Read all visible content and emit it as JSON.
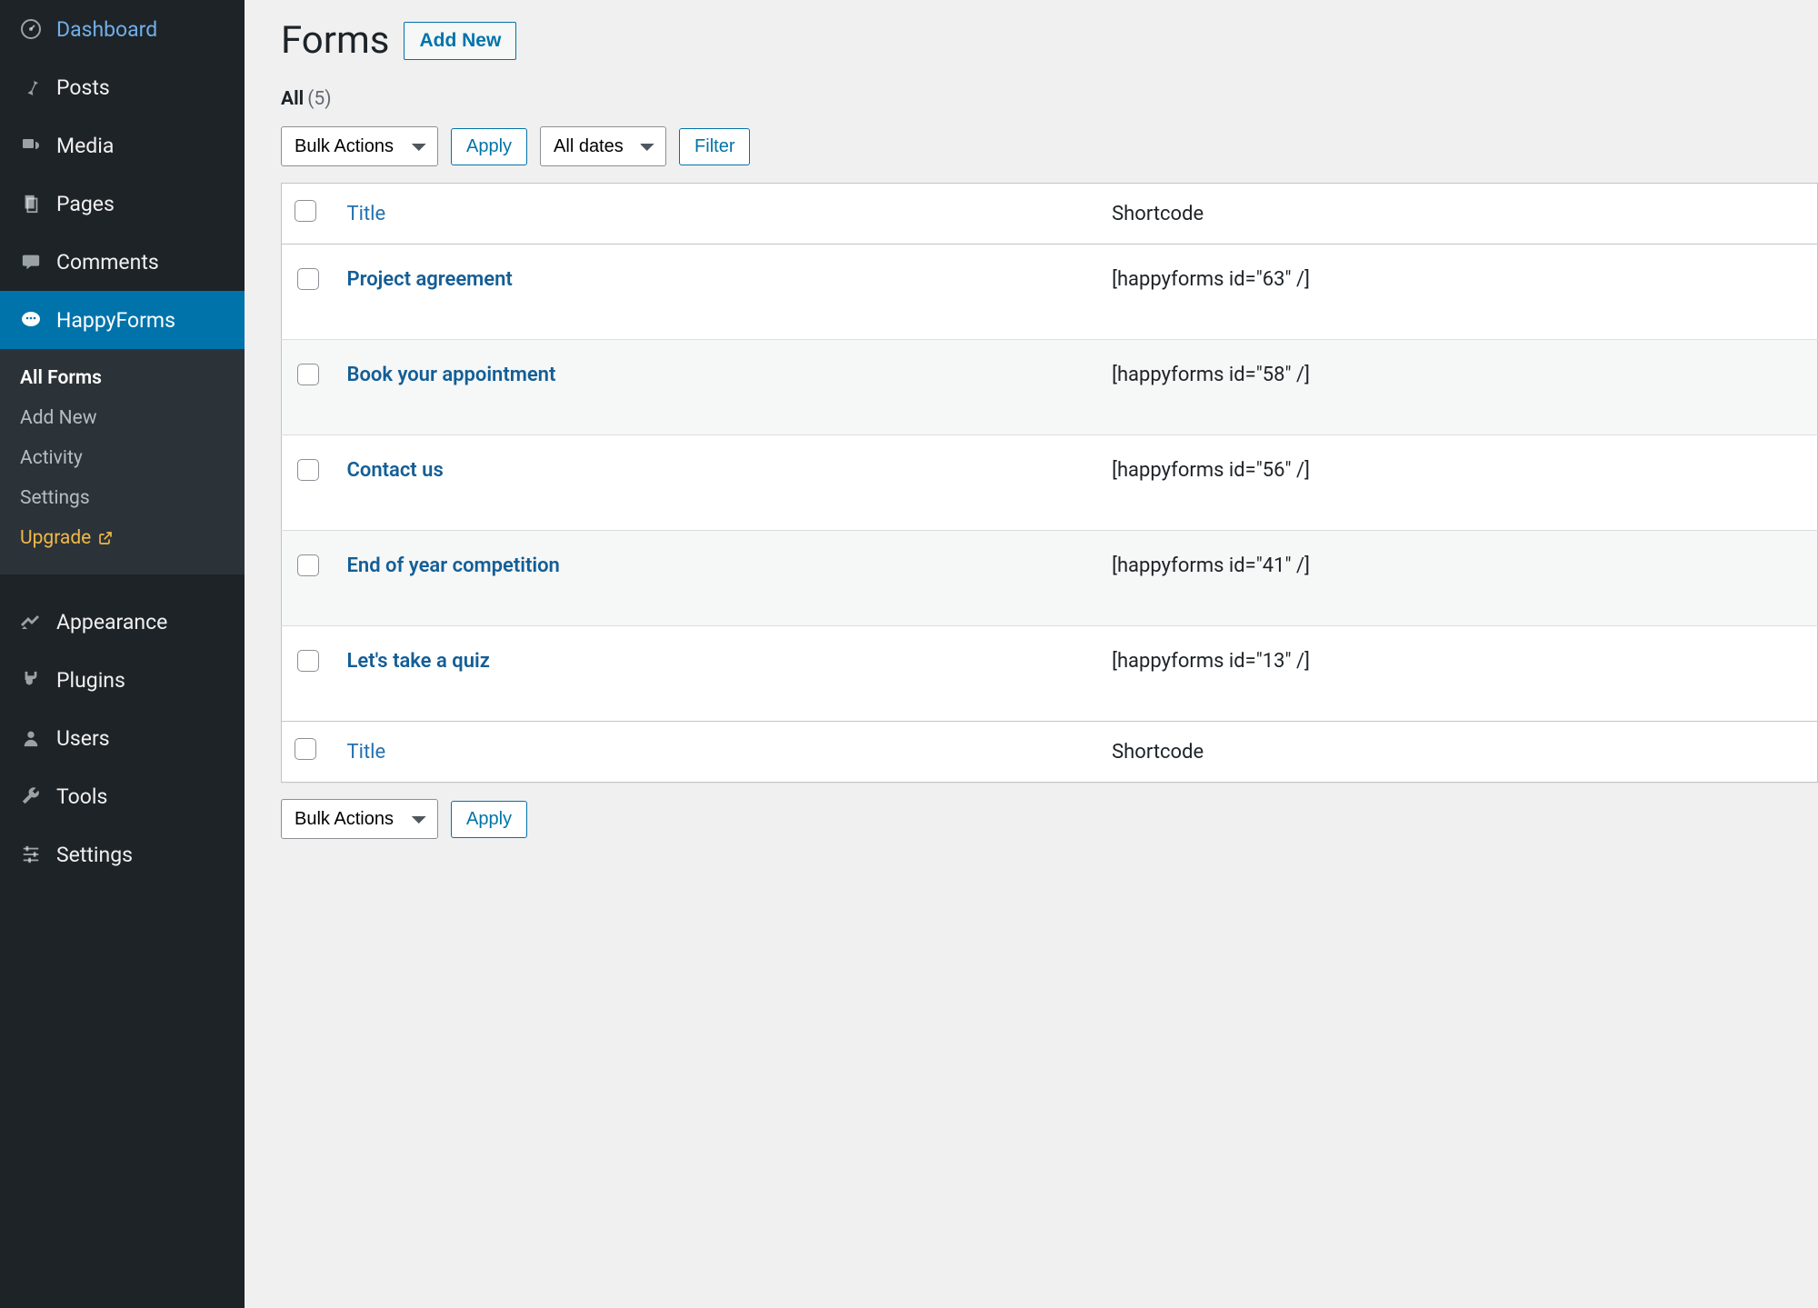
{
  "sidebar": {
    "items": [
      {
        "label": "Dashboard",
        "icon": "dashboard"
      },
      {
        "label": "Posts",
        "icon": "pin"
      },
      {
        "label": "Media",
        "icon": "media"
      },
      {
        "label": "Pages",
        "icon": "pages"
      },
      {
        "label": "Comments",
        "icon": "comments"
      },
      {
        "label": "HappyForms",
        "icon": "happyforms",
        "active": true
      },
      {
        "label": "Appearance",
        "icon": "appearance"
      },
      {
        "label": "Plugins",
        "icon": "plugins"
      },
      {
        "label": "Users",
        "icon": "users"
      },
      {
        "label": "Tools",
        "icon": "tools"
      },
      {
        "label": "Settings",
        "icon": "settings"
      }
    ],
    "submenu": [
      {
        "label": "All Forms",
        "current": true
      },
      {
        "label": "Add New"
      },
      {
        "label": "Activity"
      },
      {
        "label": "Settings"
      },
      {
        "label": "Upgrade",
        "upgrade": true
      }
    ]
  },
  "page": {
    "title": "Forms",
    "add_new": "Add New"
  },
  "filters": {
    "all_label": "All",
    "count": "(5)"
  },
  "tablenav": {
    "bulk": "Bulk Actions",
    "apply": "Apply",
    "dates": "All dates",
    "filter": "Filter"
  },
  "table": {
    "columns": {
      "title": "Title",
      "shortcode": "Shortcode"
    },
    "rows": [
      {
        "title": "Project agreement",
        "shortcode": "[happyforms id=\"63\" /]"
      },
      {
        "title": "Book your appointment",
        "shortcode": "[happyforms id=\"58\" /]"
      },
      {
        "title": "Contact us",
        "shortcode": "[happyforms id=\"56\" /]"
      },
      {
        "title": "End of year competition",
        "shortcode": "[happyforms id=\"41\" /]"
      },
      {
        "title": "Let's take a quiz",
        "shortcode": "[happyforms id=\"13\" /]"
      }
    ]
  }
}
